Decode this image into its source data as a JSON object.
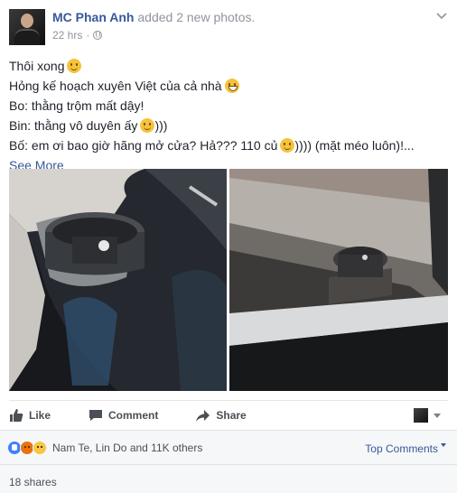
{
  "post": {
    "author": "MC Phan Anh",
    "action": "added 2 new photos.",
    "time": "22 hrs",
    "separator": "·",
    "lines": [
      "Thôi xong",
      "Hỏng kế hoạch xuyên Việt của cả nhà",
      "Bo: thằng trộm mất dậy!",
      "Bin: thằng vô duyên ấy",
      "Bố: em ơi bao giờ hãng mở cửa? Hả??? 110 củ"
    ],
    "line3_suffix": ")))",
    "line4_suffix": ")))) (mặt méo luôn)!...",
    "see_more": "See More"
  },
  "actions": {
    "like": "Like",
    "comment": "Comment",
    "share": "Share"
  },
  "reactions": {
    "summary": "Nam Te, Lin Do and 11K others",
    "top_comments": "Top Comments"
  },
  "shares": "18 shares",
  "icons": {
    "like": "thumbs-up-icon",
    "comment": "speech-bubble-icon",
    "share": "share-arrow-icon",
    "privacy": "globe-icon",
    "menu": "chevron-down-icon"
  },
  "colors": {
    "link": "#365899",
    "meta": "#90949c",
    "like_reaction": "#4080ff",
    "angry_reaction": "#e9710f",
    "sad_reaction": "#f7c644"
  }
}
